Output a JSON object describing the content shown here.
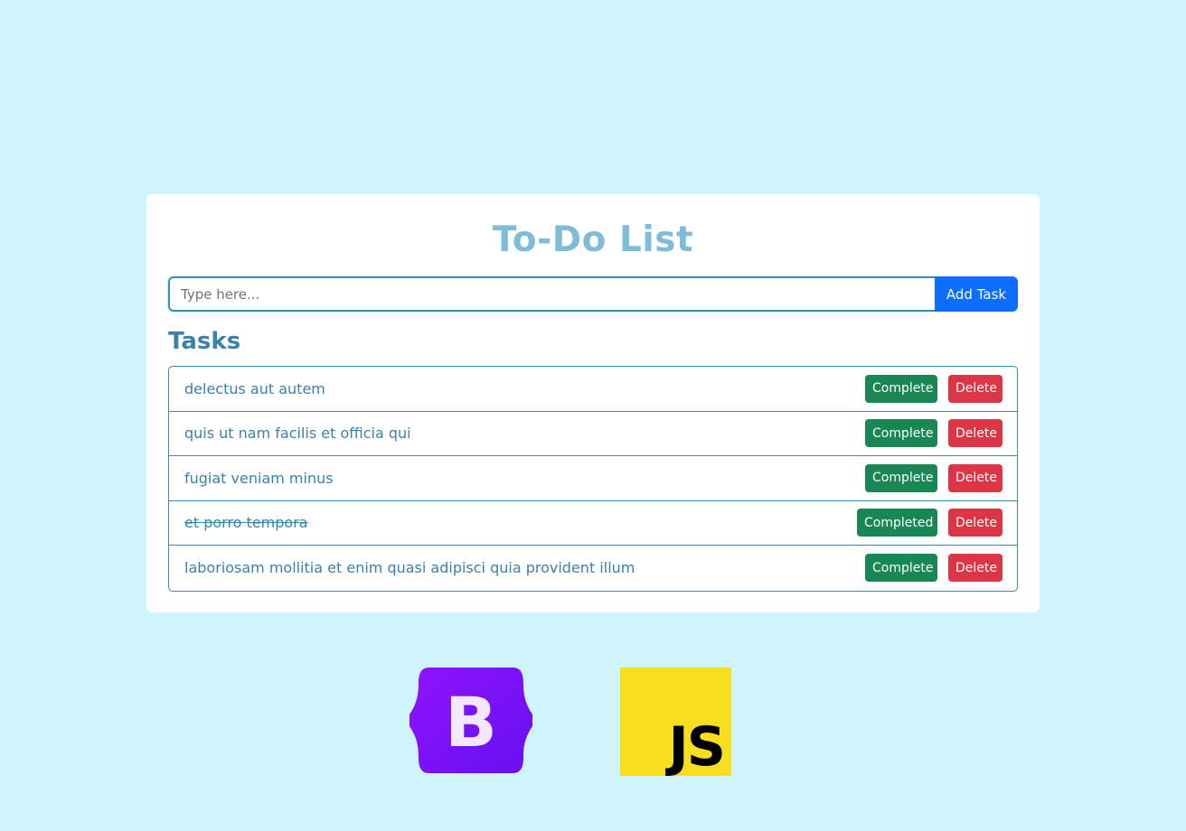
{
  "app": {
    "title": "To-Do List"
  },
  "input": {
    "placeholder": "Type here...",
    "value": "",
    "add_label": "Add Task"
  },
  "tasks_heading": "Tasks",
  "tasks": [
    {
      "text": "delectus aut autem",
      "status_label": "Complete",
      "delete_label": "Delete",
      "completed": false
    },
    {
      "text": "quis ut nam facilis et officia qui",
      "status_label": "Complete",
      "delete_label": "Delete",
      "completed": false
    },
    {
      "text": "fugiat veniam minus",
      "status_label": "Complete",
      "delete_label": "Delete",
      "completed": false
    },
    {
      "text": "et porro tempora",
      "status_label": "Completed",
      "delete_label": "Delete",
      "completed": true
    },
    {
      "text": "laboriosam mollitia et enim quasi adipisci quia provident illum",
      "status_label": "Complete",
      "delete_label": "Delete",
      "completed": false
    }
  ],
  "logos": {
    "bootstrap": {
      "letter": "B",
      "icon": "bootstrap-logo-icon",
      "color": "#7a16f2"
    },
    "javascript": {
      "text": "JS",
      "icon": "javascript-logo-icon",
      "color": "#f7df1e"
    }
  },
  "colors": {
    "background": "#cff4fc",
    "accent": "#0d6efd",
    "success": "#198754",
    "danger": "#dc3545",
    "title": "#7fbcd8",
    "text": "#3a82a8"
  }
}
